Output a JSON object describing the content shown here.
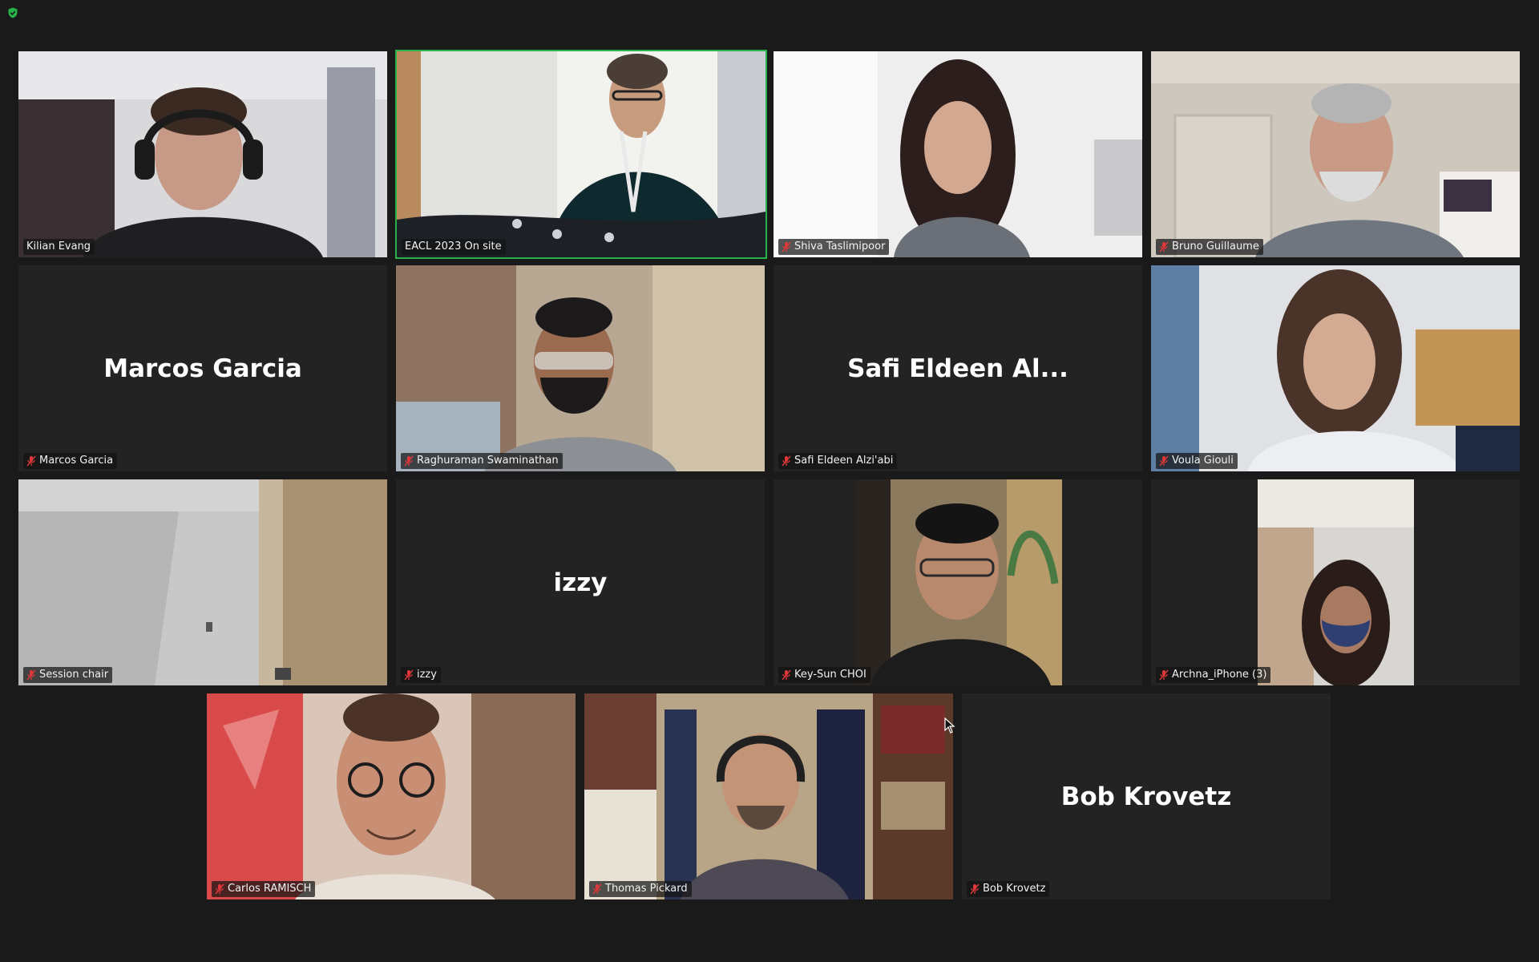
{
  "meeting": {
    "security_icon": "shield-check-icon",
    "accent_color": "#27b24a",
    "muted_color": "#e0373a"
  },
  "participants": [
    {
      "name": "Kilian Evang",
      "tag": "Kilian Evang",
      "muted": false,
      "video": true,
      "speaking": false
    },
    {
      "name": "EACL 2023 On site",
      "tag": "EACL 2023 On site",
      "muted": false,
      "video": true,
      "speaking": true
    },
    {
      "name": "Shiva Taslimipoor",
      "tag": "Shiva Taslimipoor",
      "muted": true,
      "video": true,
      "speaking": false
    },
    {
      "name": "Bruno Guillaume",
      "tag": "Bruno Guillaume",
      "muted": true,
      "video": true,
      "speaking": false
    },
    {
      "name": "Marcos Garcia",
      "tag": "Marcos Garcia",
      "muted": true,
      "video": false,
      "speaking": false
    },
    {
      "name": "Raghuraman Swaminathan",
      "tag": "Raghuraman Swaminathan",
      "muted": true,
      "video": true,
      "speaking": false
    },
    {
      "name": "Safi Eldeen Al...",
      "tag": "Safi Eldeen Alzi'abi",
      "muted": true,
      "video": false,
      "speaking": false
    },
    {
      "name": "Voula Giouli",
      "tag": "Voula Giouli",
      "muted": true,
      "video": true,
      "speaking": false
    },
    {
      "name": "Session chair",
      "tag": "Session chair",
      "muted": true,
      "video": true,
      "speaking": false
    },
    {
      "name": "izzy",
      "tag": "izzy",
      "muted": true,
      "video": false,
      "speaking": false
    },
    {
      "name": "Key-Sun CHOI",
      "tag": "Key-Sun CHOI",
      "muted": true,
      "video": true,
      "speaking": false
    },
    {
      "name": "Archna_iPhone (3)",
      "tag": "Archna_iPhone (3)",
      "muted": true,
      "video": true,
      "speaking": false
    },
    {
      "name": "Carlos RAMISCH",
      "tag": "Carlos RAMISCH",
      "muted": true,
      "video": true,
      "speaking": false
    },
    {
      "name": "Thomas Pickard",
      "tag": "Thomas Pickard",
      "muted": true,
      "video": true,
      "speaking": false
    },
    {
      "name": "Bob Krovetz",
      "tag": "Bob Krovetz",
      "muted": true,
      "video": false,
      "speaking": false
    }
  ]
}
